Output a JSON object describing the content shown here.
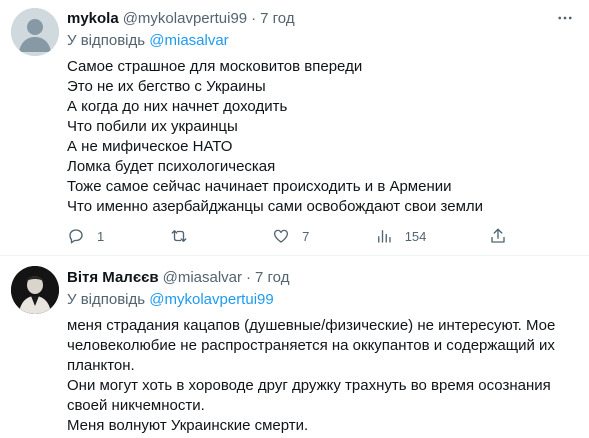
{
  "tweet1": {
    "name": "mykola",
    "handle": "@mykolavpertui99",
    "separator": "·",
    "time": "7 год",
    "reply_prefix": "У відповідь",
    "reply_to": "@miasalvar",
    "lines": [
      "Самое страшное для московитов впереди",
      "Это не их бегство с Украины",
      "А когда до них начнет доходить",
      "Что побили их украинцы",
      "А не мифическое НАТО",
      "Ломка будет психологическая",
      "Тоже самое сейчас начинает происходить и в Армении",
      "Что именно азербайджанцы сами освобождают свои земли"
    ],
    "replies_count": "1",
    "retweets_count": "",
    "likes_count": "7",
    "views_count": "154",
    "icons": {
      "reply": "reply-icon",
      "retweet": "retweet-icon",
      "like": "heart-icon",
      "views": "views-icon",
      "share": "share-icon",
      "more": "more-icon"
    }
  },
  "tweet2": {
    "name": "Вітя Малєєв",
    "handle": "@miasalvar",
    "separator": "·",
    "time": "7 год",
    "reply_prefix": "У відповідь",
    "reply_to": "@mykolavpertui99",
    "lines": [
      "меня страдания кацапов (душевные/физические) не интересуют. Мое",
      "человеколюбие не распространяется на оккупантов и содержащий их",
      "планктон.",
      "Они могут хоть в хороводе друг дружку трахнуть во время осознания",
      "своей никчемности.",
      "Меня волнуют Украинские смерти."
    ]
  },
  "colors": {
    "text": "#0f1419",
    "secondary": "#536471",
    "accent": "#1d9bf0",
    "divider": "#eff3f4"
  }
}
